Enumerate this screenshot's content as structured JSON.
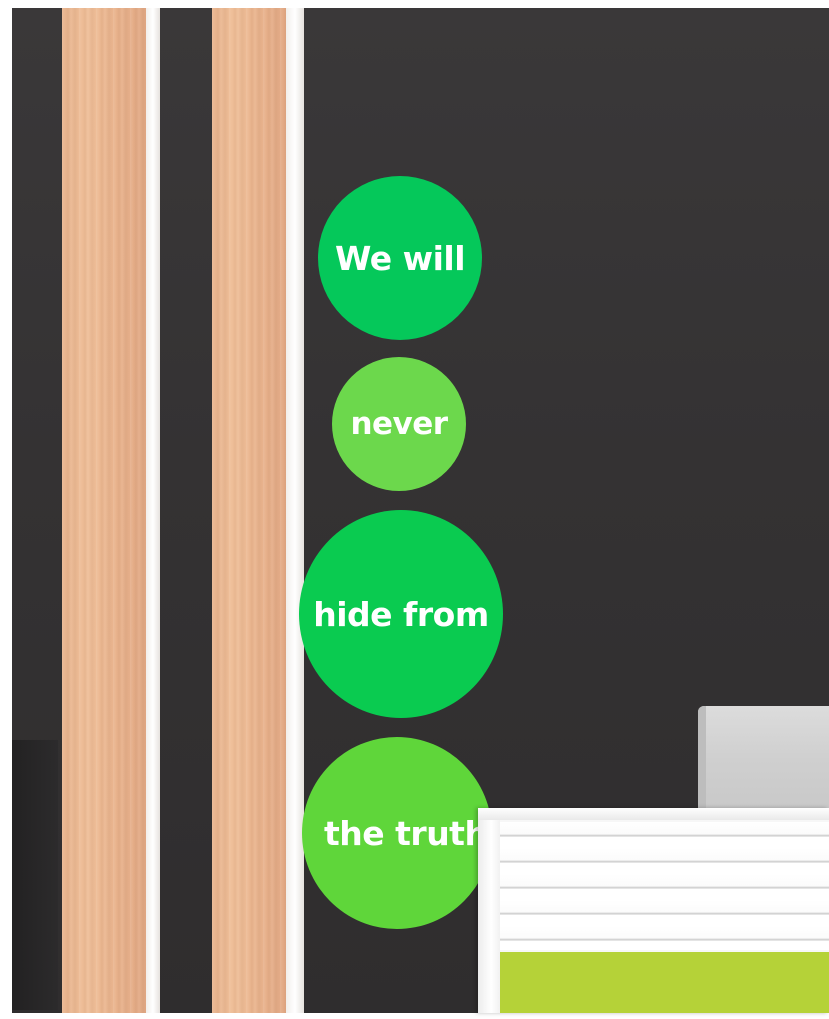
{
  "scene": {
    "description_free": true,
    "wall_color": "#353334",
    "wood_color": "#ebb790",
    "desk_accent_color": "#b5d238"
  },
  "circles": [
    {
      "text": "We will",
      "color": "#05c85a"
    },
    {
      "text": "never",
      "color": "#6cd84c"
    },
    {
      "text": "hide from",
      "color": "#0acb50"
    },
    {
      "text": "the truth",
      "color": "#5fd63a"
    }
  ]
}
